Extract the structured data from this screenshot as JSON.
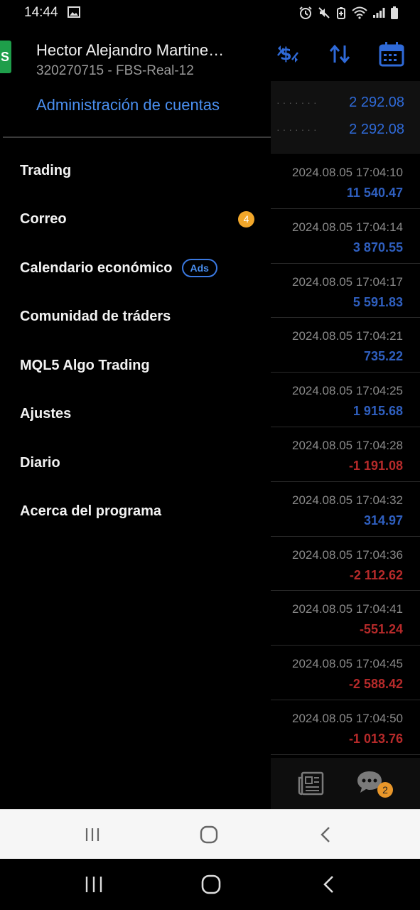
{
  "status_bar": {
    "time": "14:44",
    "icons": [
      "image-icon",
      "alarm-icon",
      "mute-icon",
      "battery-saver-icon",
      "wifi-icon",
      "signal-icon",
      "battery-icon"
    ]
  },
  "account": {
    "avatar_letter": "S",
    "name": "Hector Alejandro Martine…",
    "number": "320270715 - FBS-Real-12",
    "manage_label": "Administración de cuentas"
  },
  "menu": {
    "items": [
      {
        "label": "Trading"
      },
      {
        "label": "Correo",
        "badge": "4"
      },
      {
        "label": "Calendario económico",
        "tag": "Ads"
      },
      {
        "label": "Comunidad de tráders"
      },
      {
        "label": "MQL5 Algo Trading"
      },
      {
        "label": "Ajustes"
      },
      {
        "label": "Diario"
      },
      {
        "label": "Acerca del programa"
      }
    ]
  },
  "background": {
    "toolbar_icons": [
      "currency-exchange-icon",
      "sort-icon",
      "calendar-icon"
    ],
    "balance": [
      "2 292.08",
      "2 292.08"
    ],
    "deals": [
      {
        "time": "2024.08.05 17:04:10",
        "value": "11 540.47",
        "color": "#2f5fbf"
      },
      {
        "time": "2024.08.05 17:04:14",
        "value": "3 870.55",
        "color": "#2f5fbf"
      },
      {
        "time": "2024.08.05 17:04:17",
        "value": "5 591.83",
        "color": "#2f5fbf"
      },
      {
        "time": "2024.08.05 17:04:21",
        "value": "735.22",
        "color": "#2f5fbf"
      },
      {
        "time": "2024.08.05 17:04:25",
        "value": "1 915.68",
        "color": "#2f5fbf"
      },
      {
        "time": "2024.08.05 17:04:28",
        "value": "-1 191.08",
        "color": "#b72a2a"
      },
      {
        "time": "2024.08.05 17:04:32",
        "value": "314.97",
        "color": "#2f5fbf"
      },
      {
        "time": "2024.08.05 17:04:36",
        "value": "-2 112.62",
        "color": "#b72a2a"
      },
      {
        "time": "2024.08.05 17:04:41",
        "value": "-551.24",
        "color": "#b72a2a"
      },
      {
        "time": "2024.08.05 17:04:45",
        "value": "-2 588.42",
        "color": "#b72a2a"
      },
      {
        "time": "2024.08.05 17:04:50",
        "value": "-1 013.76",
        "color": "#b72a2a"
      }
    ],
    "chat_badge": "2"
  },
  "colors": {
    "accent_blue": "#4a8ff0",
    "profit_blue": "#2f5fbf",
    "loss_red": "#b72a2a",
    "badge_orange": "#f2a72a"
  }
}
